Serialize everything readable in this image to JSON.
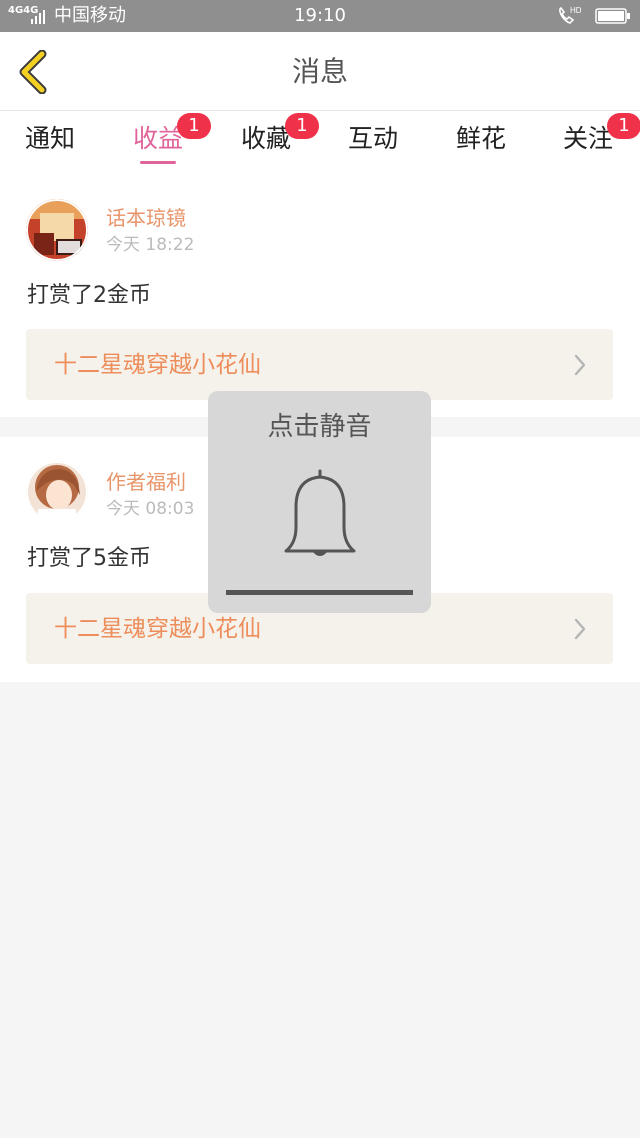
{
  "status_bar": {
    "signal": "4G4G",
    "carrier": "中国移动",
    "time": "19:10",
    "hd": "HD"
  },
  "header": {
    "title": "消息",
    "back_icon": "chevron-left-icon"
  },
  "tabs": [
    {
      "label": "通知",
      "badge": null
    },
    {
      "label": "收益",
      "badge": "1",
      "active": true
    },
    {
      "label": "收藏",
      "badge": "1"
    },
    {
      "label": "互动",
      "badge": null
    },
    {
      "label": "鲜花",
      "badge": null
    },
    {
      "label": "关注",
      "badge": "1"
    }
  ],
  "messages": [
    {
      "author": "话本琼镜",
      "time": "今天 18:22",
      "text": "打赏了2金币",
      "book": "十二星魂穿越小花仙"
    },
    {
      "author": "作者福利",
      "time": "今天 08:03",
      "text": "打赏了5金币",
      "book": "十二星魂穿越小花仙"
    }
  ],
  "toast": {
    "label": "点击静音",
    "icon": "bell-icon"
  },
  "colors": {
    "accent": "#e0649a",
    "badge": "#f0314a",
    "author": "#e8956a",
    "book": "#ee8d5b",
    "back_arrow": "#f5d020"
  }
}
